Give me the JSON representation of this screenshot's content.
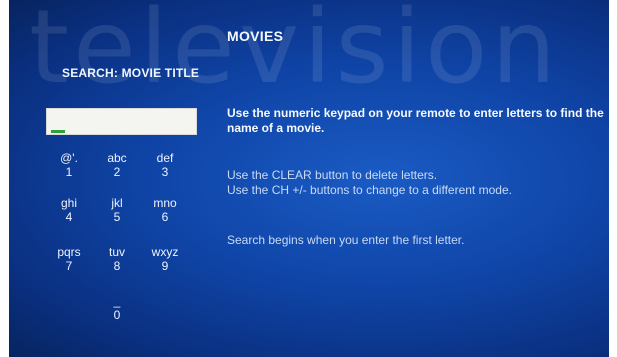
{
  "watermark": "television",
  "section_title": "MOVIES",
  "search": {
    "label": "SEARCH: MOVIE TITLE",
    "value": ""
  },
  "keypad": [
    {
      "letters": "@'.",
      "digit": "1"
    },
    {
      "letters": "abc",
      "digit": "2"
    },
    {
      "letters": "def",
      "digit": "3"
    },
    {
      "letters": "ghi",
      "digit": "4"
    },
    {
      "letters": "jkl",
      "digit": "5"
    },
    {
      "letters": "mno",
      "digit": "6"
    },
    {
      "letters": "pqrs",
      "digit": "7"
    },
    {
      "letters": "tuv",
      "digit": "8"
    },
    {
      "letters": "wxyz",
      "digit": "9"
    },
    {
      "letters": "_",
      "digit": "0"
    }
  ],
  "instructions": {
    "primary": "Use the numeric keypad on your remote to enter letters to find the name of a movie.",
    "clear": "Use the CLEAR button to delete letters.",
    "mode": "Use the CH +/- buttons to change to a different mode.",
    "begins": "Search begins when you enter the first letter."
  },
  "colors": {
    "background": "#0f44a6",
    "input_background": "#f4f4f0",
    "caret": "#2ea33c",
    "secondary_text": "#c9daf5"
  }
}
